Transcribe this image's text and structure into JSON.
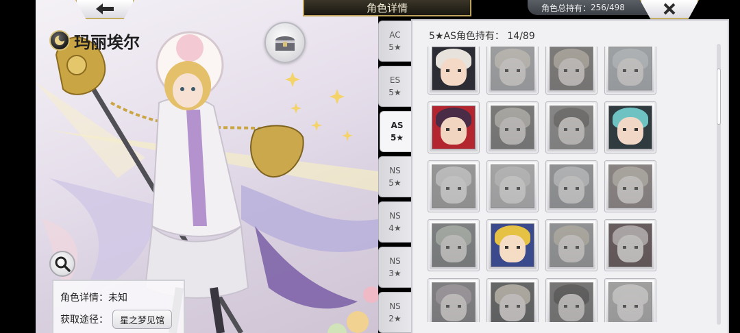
{
  "header": {
    "title": "角色详情",
    "total_label": "角色总持有：",
    "total_value": "256/498"
  },
  "character": {
    "name": "玛丽埃尔",
    "detail_label": "角色详情：",
    "detail_value": "未知",
    "source_label": "获取途径：",
    "source_value": "星之梦见馆"
  },
  "tabs": [
    {
      "line1": "AC",
      "line2": "5★"
    },
    {
      "line1": "ES",
      "line2": "5★"
    },
    {
      "line1": "AS",
      "line2": "5★"
    },
    {
      "line1": "NS",
      "line2": "5★"
    },
    {
      "line1": "NS",
      "line2": "4★"
    },
    {
      "line1": "NS",
      "line2": "3★"
    },
    {
      "line1": "NS",
      "line2": "2★"
    }
  ],
  "active_tab": 2,
  "grid": {
    "count_label": "5★AS角色持有：",
    "count_value": "14/89"
  },
  "portraits": [
    {
      "hair": "#e7e2dc",
      "face": "#f3d9c6",
      "bg": "#2c2c34",
      "owned": true
    },
    {
      "hair": "#e8c98a",
      "face": "#f2dccb",
      "bg": "#9aa5b5",
      "owned": false
    },
    {
      "hair": "#d7a84f",
      "face": "#f0cfae",
      "bg": "#7a6a55",
      "owned": false
    },
    {
      "hair": "#a8cde0",
      "face": "#f3dccd",
      "bg": "#8db0c7",
      "owned": false
    },
    {
      "hair": "#4a2c46",
      "face": "#f2d5c0",
      "bg": "#b3262f",
      "owned": true
    },
    {
      "hair": "#c9b07a",
      "face": "#e5cdb6",
      "bg": "#6f6a62",
      "owned": false
    },
    {
      "hair": "#6b5446",
      "face": "#e8cdb8",
      "bg": "#8a7c72",
      "owned": false
    },
    {
      "hair": "#6fc2c2",
      "face": "#f1d7c6",
      "bg": "#2f3b3f",
      "owned": true
    },
    {
      "hair": "#d6d6d6",
      "face": "#e6e6e6",
      "bg": "#9a9a9a",
      "owned": false
    },
    {
      "hair": "#cfc8c8",
      "face": "#ece2dc",
      "bg": "#aeb1b8",
      "owned": false
    },
    {
      "hair": "#b9c8d6",
      "face": "#e7dbd2",
      "bg": "#8593a2",
      "owned": false
    },
    {
      "hair": "#d6ae63",
      "face": "#f2d8c2",
      "bg": "#b46d63",
      "owned": false
    },
    {
      "hair": "#8fc27a",
      "face": "#ddd6c8",
      "bg": "#5d7780",
      "owned": false
    },
    {
      "hair": "#e5c244",
      "face": "#f5dcc5",
      "bg": "#3b4a8c",
      "owned": true
    },
    {
      "hair": "#d8b35a",
      "face": "#eed7bf",
      "bg": "#85939c",
      "owned": false
    },
    {
      "hair": "#e7a3ad",
      "face": "#f2d9cc",
      "bg": "#a1222d",
      "owned": false
    },
    {
      "hair": "#b98bb3",
      "face": "#eed4c4",
      "bg": "#7c6d8a",
      "owned": false
    },
    {
      "hair": "#e3b54f",
      "face": "#f2d6c0",
      "bg": "#3f4b4a",
      "owned": false
    },
    {
      "hair": "#4b3c36",
      "face": "#e6c9b4",
      "bg": "#6a6259",
      "owned": false
    },
    {
      "hair": "#e6e0d7",
      "face": "#f1dfd1",
      "bg": "#b0a7a2",
      "owned": false
    }
  ],
  "colors": {
    "gold": "#c5ae62",
    "title_bg": "#2a261c",
    "panel_bg": "#f1f1f3"
  },
  "icons": {
    "back": "arrow-left-icon",
    "close": "close-x-icon",
    "search": "magnifier-icon",
    "chest": "treasure-chest-icon"
  }
}
